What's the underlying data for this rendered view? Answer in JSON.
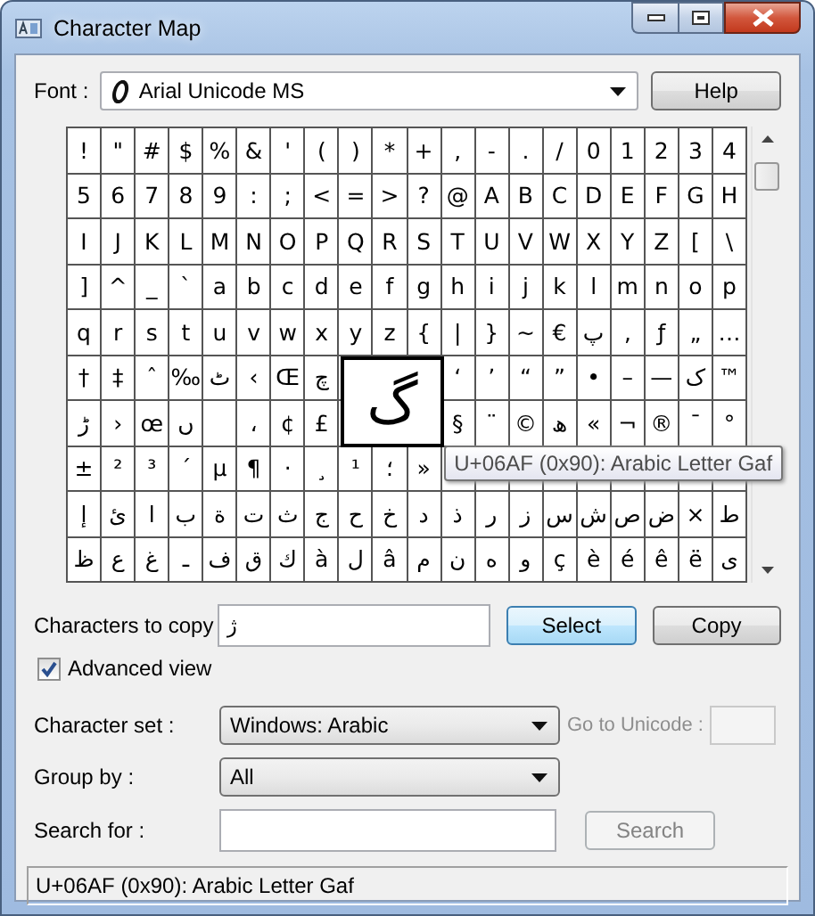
{
  "window": {
    "title": "Character Map"
  },
  "font": {
    "label": "Font :",
    "value": "Arial Unicode MS"
  },
  "help_button": "Help",
  "grid": {
    "rows": [
      [
        "!",
        "\"",
        "#",
        "$",
        "%",
        "&",
        "'",
        "(",
        ")",
        "*",
        "+",
        ",",
        "-",
        ".",
        "/",
        "0",
        "1",
        "2",
        "3",
        "4"
      ],
      [
        "5",
        "6",
        "7",
        "8",
        "9",
        ":",
        ";",
        "<",
        "=",
        ">",
        "?",
        "@",
        "A",
        "B",
        "C",
        "D",
        "E",
        "F",
        "G",
        "H"
      ],
      [
        "I",
        "J",
        "K",
        "L",
        "M",
        "N",
        "O",
        "P",
        "Q",
        "R",
        "S",
        "T",
        "U",
        "V",
        "W",
        "X",
        "Y",
        "Z",
        "[",
        "\\"
      ],
      [
        "]",
        "^",
        "_",
        "`",
        "a",
        "b",
        "c",
        "d",
        "e",
        "f",
        "g",
        "h",
        "i",
        "j",
        "k",
        "l",
        "m",
        "n",
        "o",
        "p"
      ],
      [
        "q",
        "r",
        "s",
        "t",
        "u",
        "v",
        "w",
        "x",
        "y",
        "z",
        "{",
        "|",
        "}",
        "~",
        "€",
        "پ",
        "‚",
        "ƒ",
        "„",
        "…"
      ],
      [
        "†",
        "‡",
        "ˆ",
        "‰",
        "ٹ",
        "‹",
        "Œ",
        "چ",
        null,
        null,
        null,
        "‘",
        "’",
        "“",
        "”",
        "•",
        "–",
        "—",
        "ک",
        "™"
      ],
      [
        "ڑ",
        "›",
        "œ",
        "ں",
        null,
        "،",
        "¢",
        "£",
        null,
        null,
        null,
        "§",
        "¨",
        "©",
        "ھ",
        "«",
        "¬",
        "®",
        "¯",
        "°"
      ],
      [
        "±",
        "²",
        "³",
        "´",
        "µ",
        "¶",
        "·",
        "¸",
        "¹",
        "؛",
        "»",
        null,
        null,
        null,
        null,
        null,
        null,
        null,
        null,
        null
      ],
      [
        "إ",
        "ئ",
        "ا",
        "ب",
        "ة",
        "ت",
        "ث",
        "ج",
        "ح",
        "خ",
        "د",
        "ذ",
        "ر",
        "ز",
        "س",
        "ش",
        "ص",
        "ض",
        "×",
        "ط"
      ],
      [
        "ظ",
        "ع",
        "غ",
        "ـ",
        "ف",
        "ق",
        "ك",
        "à",
        "ل",
        "â",
        "م",
        "ن",
        "ه",
        "و",
        "ç",
        "è",
        "é",
        "ê",
        "ë",
        "ى"
      ]
    ]
  },
  "magnifier": "گ",
  "tooltip": "U+06AF (0x90): Arabic Letter Gaf",
  "copy": {
    "label": "Characters to copy",
    "value": "ژ"
  },
  "select_button": "Select",
  "copy_button": "Copy",
  "advanced_view": {
    "label": "Advanced view",
    "checked": true
  },
  "character_set": {
    "label": "Character set :",
    "value": "Windows: Arabic"
  },
  "goto_unicode": {
    "label": "Go to Unicode :",
    "disabled": true
  },
  "group_by": {
    "label": "Group by :",
    "value": "All"
  },
  "search": {
    "label": "Search for :",
    "button": "Search",
    "button_disabled": true
  },
  "status_bar": "U+06AF (0x90): Arabic Letter Gaf"
}
